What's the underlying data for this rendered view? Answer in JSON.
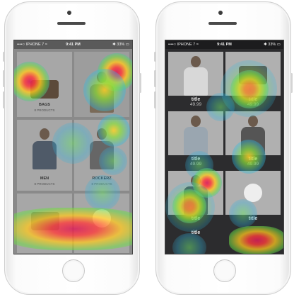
{
  "phones": [
    {
      "statusbar": {
        "carrier": "••••○ IPHONE 7 ≈",
        "time": "9:41 PM",
        "battery": "✱ 33% ▭"
      },
      "tiles": [
        {
          "label": "BAGS",
          "sub": "8 PRODUCTS"
        },
        {
          "label": "MEN",
          "sub": "8 PRODUCTS"
        },
        {
          "label": "ROCKERZ",
          "sub": "8 PRODUCTS"
        }
      ]
    },
    {
      "statusbar": {
        "carrier": "••••○ IPHONE 7 ≈",
        "time": "9:41 PM",
        "battery": "✱ 33% ▭"
      },
      "products": [
        {
          "title": "title",
          "price": "49.99"
        },
        {
          "title": "title",
          "price": "49.99"
        },
        {
          "title": "title",
          "price": "49.99"
        },
        {
          "title": "title",
          "price": "49.99"
        },
        {
          "title": "title",
          "price": ""
        },
        {
          "title": "title",
          "price": ""
        },
        {
          "title": "title",
          "price": ""
        },
        {
          "title": "",
          "price": ""
        }
      ]
    }
  ],
  "colors": {
    "phone_body": "#ffffff",
    "left_screen": "#8a8a8a",
    "right_screen": "#2c2c2e"
  }
}
